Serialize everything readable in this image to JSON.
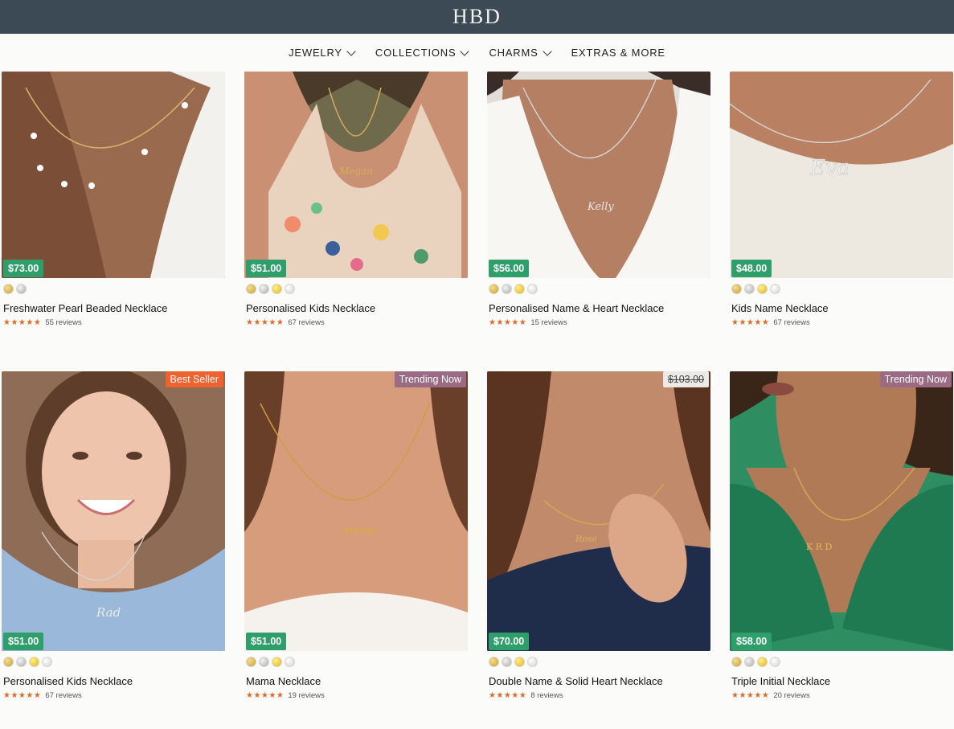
{
  "brand": {
    "logo": "HBD"
  },
  "nav": [
    {
      "label": "JEWELRY",
      "has_menu": true
    },
    {
      "label": "COLLECTIONS",
      "has_menu": true
    },
    {
      "label": "CHARMS",
      "has_menu": true
    },
    {
      "label": "EXTRAS & MORE",
      "has_menu": false
    }
  ],
  "products": [
    {
      "name": "Freshwater Pearl Beaded Necklace",
      "price": "$73.00",
      "badge": "",
      "swatches": [
        "gold",
        "silver"
      ],
      "stars": "★★★★★",
      "reviews": "55 reviews"
    },
    {
      "name": "Personalised Kids Necklace",
      "price": "$51.00",
      "badge": "",
      "swatches": [
        "gold",
        "silver",
        "yellow",
        "white"
      ],
      "stars": "★★★★★",
      "reviews": "67 reviews"
    },
    {
      "name": "Personalised Name & Heart Necklace",
      "price": "$56.00",
      "badge": "",
      "swatches": [
        "gold",
        "silver",
        "yellow",
        "white"
      ],
      "stars": "★★★★★",
      "reviews": "15 reviews"
    },
    {
      "name": "Kids Name Necklace",
      "price": "$48.00",
      "badge": "",
      "swatches": [
        "gold",
        "silver",
        "yellow",
        "white"
      ],
      "stars": "★★★★★",
      "reviews": "67 reviews"
    },
    {
      "name": "Personalised Kids Necklace",
      "price": "$51.00",
      "badge": "Best Seller",
      "swatches": [
        "gold",
        "silver",
        "yellow",
        "white"
      ],
      "stars": "★★★★★",
      "reviews": "67 reviews"
    },
    {
      "name": "Mama Necklace",
      "price": "$51.00",
      "badge": "Trending Now",
      "swatches": [
        "gold",
        "silver",
        "yellow",
        "white"
      ],
      "stars": "★★★★★",
      "reviews": "19 reviews"
    },
    {
      "name": "Double Name & Solid Heart Necklace",
      "price": "$70.00",
      "badge": "$103.00",
      "swatches": [
        "gold",
        "silver",
        "yellow",
        "white"
      ],
      "stars": "★★★★★",
      "reviews": "8 reviews"
    },
    {
      "name": "Triple Initial Necklace",
      "price": "$58.00",
      "badge": "Trending Now",
      "swatches": [
        "gold",
        "silver",
        "yellow",
        "white"
      ],
      "stars": "★★★★★",
      "reviews": "20 reviews"
    }
  ],
  "colors": {
    "header_bg": "#3c4a55",
    "price_bg": "#2e9e6b",
    "best_seller_bg": "#f0622f",
    "trending_bg": "#9b6b84",
    "star": "#e06a28"
  }
}
